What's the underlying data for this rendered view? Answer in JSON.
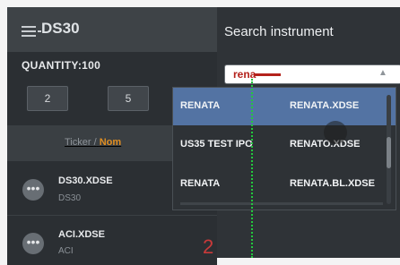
{
  "panel": {
    "title": "DS30",
    "quantity_label": "QUANTITY:100",
    "quantity_buttons": [
      "2",
      "5"
    ],
    "column_header": {
      "ticker": "Ticker",
      "separator": "/",
      "nom": "Nom"
    }
  },
  "tickers": [
    {
      "name": "DS30.XDSE",
      "sub": "DS30"
    },
    {
      "name": "ACI.XDSE",
      "sub": "ACI",
      "value": "2"
    }
  ],
  "search": {
    "title": "Search instrument",
    "value": "rena"
  },
  "dropdown": [
    {
      "name": "RENATA",
      "code": "RENATA.XDSE",
      "highlighted": true
    },
    {
      "name": "US35 TEST IPO",
      "code": "RENATO.XDSE"
    },
    {
      "name": "RENATA",
      "code": "RENATA.BL.XDSE"
    }
  ],
  "icons": {
    "menu": "hamburger-menu-icon",
    "row_action": "more-dots-icon",
    "dropdown_chevron": "chevron-up-icon"
  },
  "colors": {
    "accent_orange": "#e08e22",
    "highlight_blue": "#5373a3",
    "negative_red": "#c93a3a"
  }
}
